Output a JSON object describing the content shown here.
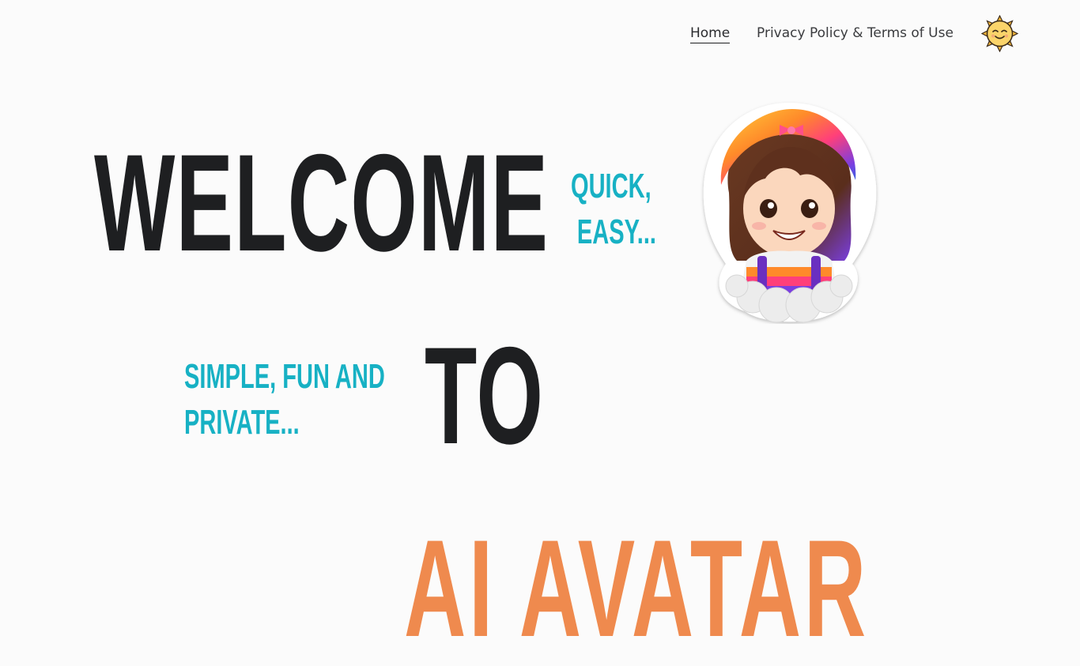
{
  "nav": {
    "home_label": "Home",
    "privacy_label": "Privacy Policy & Terms of Use",
    "logo_icon": "smiling-sun-icon"
  },
  "hero": {
    "word1": "WELCOME",
    "word2": "TO",
    "word3": "AI AVATAR",
    "tagline1_line1": "QUICK,",
    "tagline1_line2": "EASY...",
    "tagline2_line1": "SIMPLE, FUN AND",
    "tagline2_line2": "PRIVATE...",
    "avatar_icon": "girl-avatar-sticker-icon"
  },
  "colors": {
    "background": "#fbfbfb",
    "text_dark": "#1e1f21",
    "accent_teal": "#17b1c4",
    "accent_orange": "#ef8a4e"
  }
}
